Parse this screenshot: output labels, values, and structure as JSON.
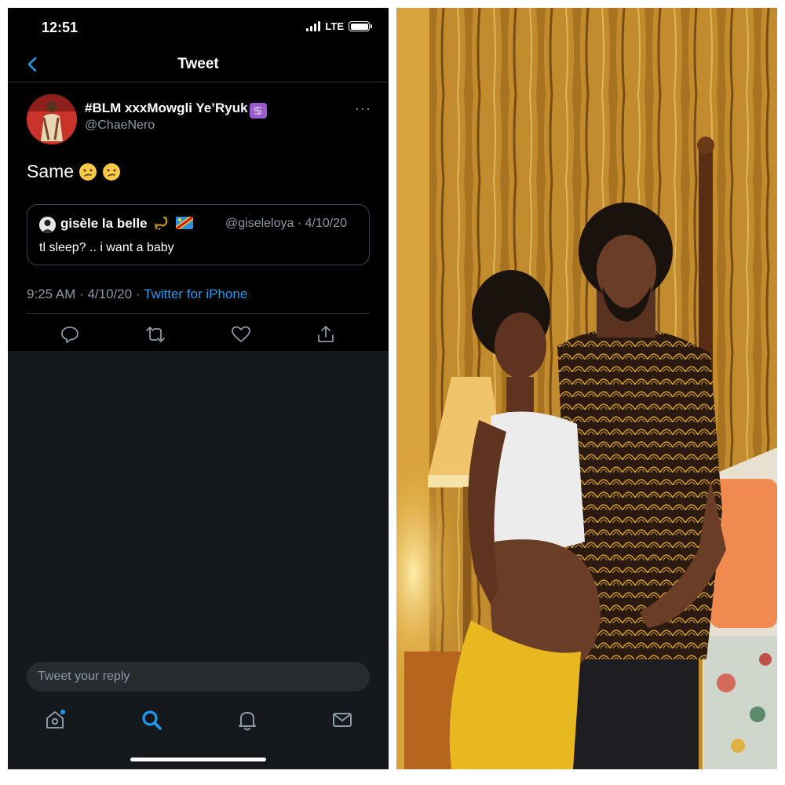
{
  "status_bar": {
    "time": "12:51",
    "network": "LTE"
  },
  "nav": {
    "title": "Tweet"
  },
  "tweet": {
    "display_name": "#BLM xxxMowgli Ye’Ryuk",
    "zodiac_glyph": "♋",
    "handle": "@ChaeNero",
    "text": "Same",
    "emojis": [
      "confused-face",
      "confused-face"
    ],
    "timestamp": "9:25 AM · 4/10/20 · ",
    "source": "Twitter for iPhone"
  },
  "quoted_tweet": {
    "name": "gisèle la belle",
    "meta": "@giseleloya · 4/10/20",
    "text": "tl sleep? .. i want a baby"
  },
  "actions": [
    "reply-icon",
    "retweet-icon",
    "like-icon",
    "share-icon"
  ],
  "reply": {
    "placeholder": "Tweet your reply"
  },
  "tab_bar": [
    "home-icon",
    "search-icon",
    "notifications-icon",
    "messages-icon"
  ],
  "colors": {
    "accent": "#1d9bf0",
    "background": "#000000",
    "secondary_text": "#8b98a5"
  }
}
